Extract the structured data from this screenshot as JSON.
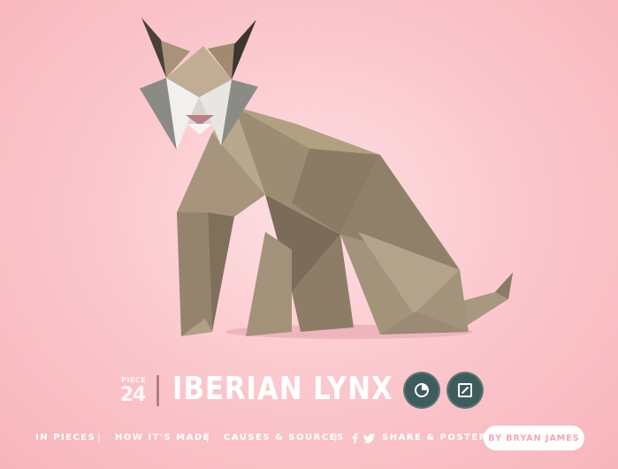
{
  "artwork": {
    "subject": "iberian-lynx",
    "colors": {
      "background": "#fbc9ce",
      "body_light": "#b5a48c",
      "body_mid": "#9a8a72",
      "body_dark": "#7a6b58",
      "ear_tip": "#3d3530",
      "face_white": "#f1f0ee",
      "face_gray": "#8b8b86",
      "nose": "#b87f86"
    }
  },
  "title": {
    "piece_label": "PIECE",
    "piece_number": "24",
    "species_name": "IBERIAN LYNX",
    "buttons": [
      {
        "icon": "pie-chart-icon"
      },
      {
        "icon": "edit-square-icon"
      }
    ],
    "button_color": "#3f5c5c"
  },
  "nav": {
    "items": [
      {
        "label": "IN PIECES"
      },
      {
        "label": "HOW IT'S MADE"
      },
      {
        "label": "CAUSES & SOURCES"
      },
      {
        "label": "SHARE & POSTER"
      }
    ],
    "separator": "|",
    "social": [
      {
        "icon": "facebook-icon"
      },
      {
        "icon": "twitter-icon"
      }
    ],
    "author_label": "BY BRYAN JAMES",
    "author_color": "#f4a6b0"
  }
}
